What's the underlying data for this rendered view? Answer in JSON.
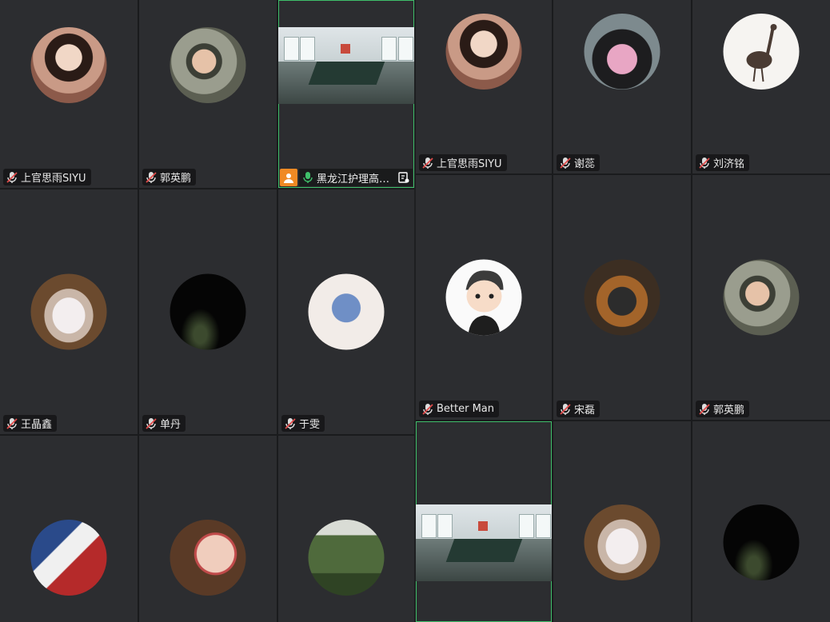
{
  "colors": {
    "tile_bg": "#2c2d30",
    "active_border": "#3fbf6a",
    "mic_muted": "#e04b4b"
  },
  "left_panel": {
    "tiles": [
      {
        "name": "上官思雨SIYU",
        "avatar": "avatar-girl-photo"
      },
      {
        "name": "郭英鹏",
        "avatar": "avatar-man-camo-cap"
      },
      {
        "name": "黑龙江护理高…",
        "avatar": "video-conference-room",
        "active": true
      },
      {
        "name": "王晶鑫",
        "avatar": "avatar-white-dress"
      },
      {
        "name": "单丹",
        "avatar": "avatar-dark"
      },
      {
        "name": "于雯",
        "avatar": "avatar-cartoon-girl"
      },
      {
        "name": "",
        "avatar": "avatar-flag-poster"
      },
      {
        "name": "",
        "avatar": "avatar-child-face"
      },
      {
        "name": "",
        "avatar": "avatar-green-mountain"
      }
    ]
  },
  "right_panel": {
    "tiles": [
      {
        "name": "上官思雨SIYU",
        "avatar": "avatar-girl-photo"
      },
      {
        "name": "谢蕊",
        "avatar": "avatar-woman-flowers"
      },
      {
        "name": "刘济铭",
        "avatar": "avatar-ostrich"
      },
      {
        "name": "Better Man",
        "avatar": "avatar-cartoon-boy"
      },
      {
        "name": "宋磊",
        "avatar": "avatar-motorcycle"
      },
      {
        "name": "郭英鹏",
        "avatar": "avatar-man-camo-cap"
      },
      {
        "name": "",
        "avatar": "video-conference-room",
        "active": true
      },
      {
        "name": "",
        "avatar": "avatar-white-dress"
      },
      {
        "name": "",
        "avatar": "avatar-dark"
      }
    ]
  }
}
